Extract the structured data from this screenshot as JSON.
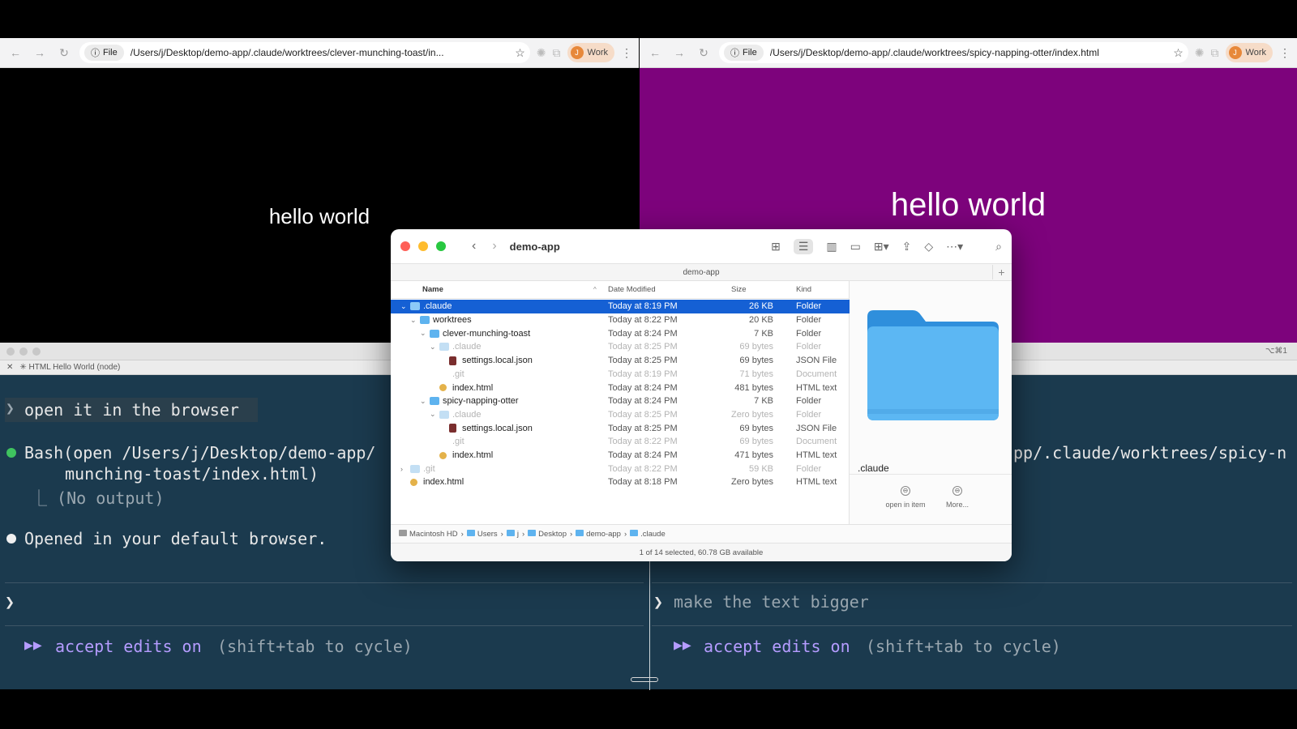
{
  "browser_left": {
    "file_chip": "File",
    "url": "/Users/j/Desktop/demo-app/.claude/worktrees/clever-munching-toast/in...",
    "profile_initial": "J",
    "profile_label": "Work",
    "page_text": "hello world",
    "page_bg": "#000000"
  },
  "browser_right": {
    "file_chip": "File",
    "url": "/Users/j/Desktop/demo-app/.claude/worktrees/spicy-napping-otter/index.html",
    "profile_initial": "J",
    "profile_label": "Work",
    "page_text": "hello world",
    "page_bg": "#7d037c"
  },
  "terminal": {
    "tab_title": "✳ HTML Hello World (node)",
    "shortcut": "⌥⌘1",
    "left": {
      "user_prompt": "open it in the browser",
      "bash_line1": "Bash(open /Users/j/Desktop/demo-app/",
      "bash_line2": "munching-toast/index.html)",
      "bash_output": "⎿  (No output)",
      "result": "Opened in your default browser.",
      "input_caret": "❯",
      "mode_icon": "▶▶",
      "mode_label": "accept edits on",
      "mode_hint": "(shift+tab to cycle)"
    },
    "right": {
      "bash_fragment": "pp/.claude/worktrees/spicy-n",
      "input_caret": "❯",
      "input_text": "make the text bigger",
      "mode_icon": "▶▶",
      "mode_label": "accept edits on",
      "mode_hint": "(shift+tab to cycle)"
    }
  },
  "finder": {
    "title": "demo-app",
    "path_title": "demo-app",
    "columns": {
      "name": "Name",
      "date": "Date Modified",
      "size": "Size",
      "kind": "Kind"
    },
    "rows": [
      {
        "name": ".claude",
        "date": "Today at 8:19 PM",
        "size": "26 KB",
        "kind": "Folder"
      },
      {
        "name": "worktrees",
        "date": "Today at 8:22 PM",
        "size": "20 KB",
        "kind": "Folder"
      },
      {
        "name": "clever-munching-toast",
        "date": "Today at 8:24 PM",
        "size": "7 KB",
        "kind": "Folder"
      },
      {
        "name": ".claude",
        "date": "Today at 8:25 PM",
        "size": "69 bytes",
        "kind": "Folder"
      },
      {
        "name": "settings.local.json",
        "date": "Today at 8:25 PM",
        "size": "69 bytes",
        "kind": "JSON File"
      },
      {
        "name": ".git",
        "date": "Today at 8:19 PM",
        "size": "71 bytes",
        "kind": "Document"
      },
      {
        "name": "index.html",
        "date": "Today at 8:24 PM",
        "size": "481 bytes",
        "kind": "HTML text"
      },
      {
        "name": "spicy-napping-otter",
        "date": "Today at 8:24 PM",
        "size": "7 KB",
        "kind": "Folder"
      },
      {
        "name": ".claude",
        "date": "Today at 8:25 PM",
        "size": "Zero bytes",
        "kind": "Folder"
      },
      {
        "name": "settings.local.json",
        "date": "Today at 8:25 PM",
        "size": "69 bytes",
        "kind": "JSON File"
      },
      {
        "name": ".git",
        "date": "Today at 8:22 PM",
        "size": "69 bytes",
        "kind": "Document"
      },
      {
        "name": "index.html",
        "date": "Today at 8:24 PM",
        "size": "471 bytes",
        "kind": "HTML text"
      },
      {
        "name": ".git",
        "date": "Today at 8:22 PM",
        "size": "59 KB",
        "kind": "Folder"
      },
      {
        "name": "index.html",
        "date": "Today at 8:18 PM",
        "size": "Zero bytes",
        "kind": "HTML text"
      }
    ],
    "preview": {
      "name": ".claude",
      "action1": "open in item",
      "action2": "More..."
    },
    "breadcrumbs": [
      "Macintosh HD",
      "Users",
      "j",
      "Desktop",
      "demo-app",
      ".claude"
    ],
    "status": "1 of 14 selected, 60.78 GB available"
  }
}
